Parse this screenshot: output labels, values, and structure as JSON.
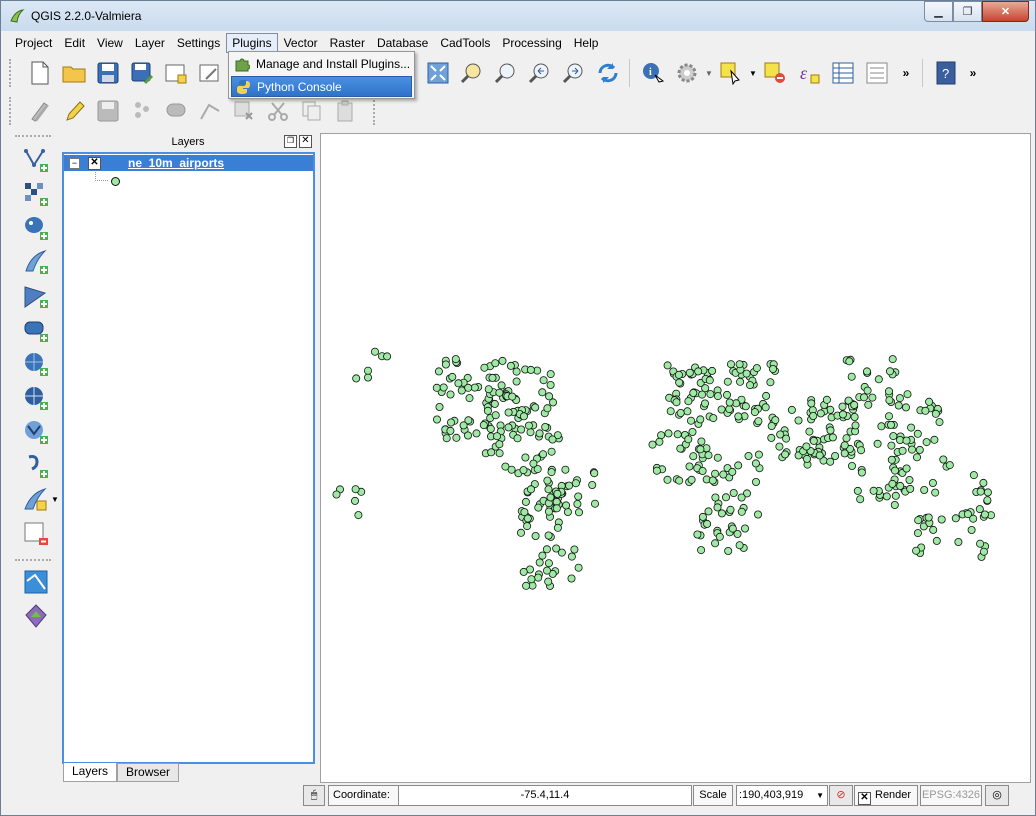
{
  "window": {
    "title": "QGIS 2.2.0-Valmiera",
    "min_icon": "minimize-icon",
    "max_icon": "maximize-icon",
    "close_icon": "close-icon"
  },
  "menubar": [
    "Project",
    "Edit",
    "View",
    "Layer",
    "Settings",
    "Plugins",
    "Vector",
    "Raster",
    "Database",
    "CadTools",
    "Processing",
    "Help"
  ],
  "plugins_menu": {
    "items": [
      {
        "label": "Manage and Install Plugins...",
        "icon": "plugin-puzzle-icon"
      },
      {
        "label": "Python Console",
        "icon": "python-icon"
      }
    ]
  },
  "layers_panel": {
    "title": "Layers",
    "layers": [
      {
        "name": "ne_10m_airports",
        "checked": true,
        "symbol_color": "#9eeaa4"
      }
    ],
    "tabs": [
      "Layers",
      "Browser"
    ]
  },
  "statusbar": {
    "coordinate_label": "Coordinate:",
    "coordinate_value": "-75.4,11.4",
    "scale_label": "Scale",
    "scale_value": ":190,403,919",
    "render_label": "Render",
    "crs": "EPSG:4326"
  },
  "colors": {
    "accent": "#3a7fd5",
    "point_fill": "#9eeaa4"
  }
}
